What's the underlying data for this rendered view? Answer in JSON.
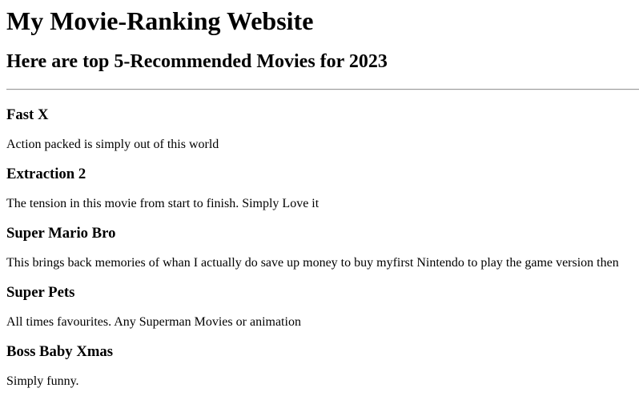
{
  "header": {
    "title": "My Movie-Ranking Website",
    "subtitle": "Here are top 5-Recommended Movies for 2023"
  },
  "movies": [
    {
      "title": "Fast X",
      "description": "Action packed is simply out of this world"
    },
    {
      "title": "Extraction 2",
      "description": "The tension in this movie from start to finish. Simply Love it"
    },
    {
      "title": "Super Mario Bro",
      "description": "This brings back memories of whan I actually do save up money to buy myfirst Nintendo to play the game version then"
    },
    {
      "title": "Super Pets",
      "description": "All times favourites. Any Superman Movies or animation"
    },
    {
      "title": "Boss Baby Xmas",
      "description": "Simply funny."
    }
  ]
}
